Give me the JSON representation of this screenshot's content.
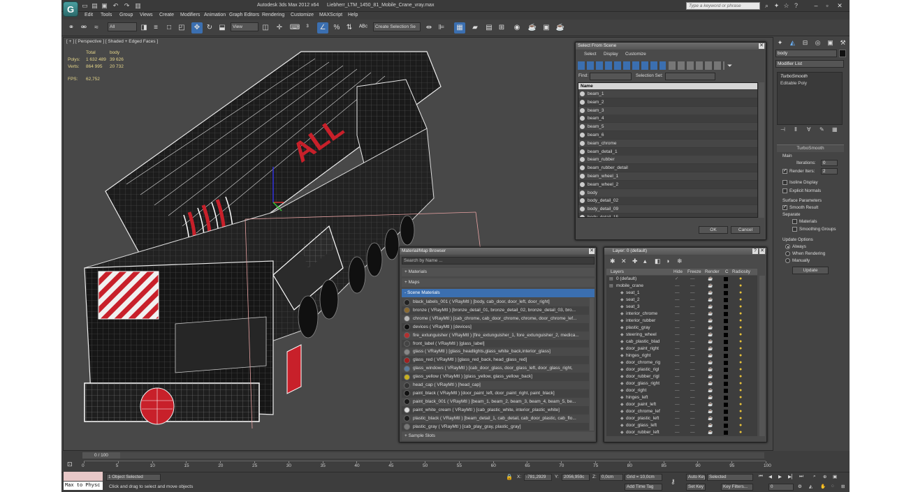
{
  "title": {
    "app": "Autodesk 3ds Max  2012 x64",
    "file": "Liebherr_LTM_1450_81_Mobile_Crane_vray.max",
    "logo_letter": "G",
    "search_placeholder": "Type a keyword or phrase"
  },
  "menu": [
    "Edit",
    "Tools",
    "Group",
    "Views",
    "Create",
    "Modifiers",
    "Animation",
    "Graph Editors",
    "Rendering",
    "Customize",
    "MAXScript",
    "Help"
  ],
  "toolbar": {
    "filter": "All",
    "ref_coord": "View",
    "selection_set": "Create Selection Se"
  },
  "viewport": {
    "label": "[ + ] [ Perspective ] [ Shaded + Edged Faces ]",
    "stats": {
      "col_total": "Total",
      "col_body": "body",
      "polys_label": "Polys:",
      "polys_total": "1 632 489",
      "polys_body": "39 626",
      "verts_label": "Verts:",
      "verts_total": "864 995",
      "verts_body": "20 732",
      "fps_label": "FPS:",
      "fps_value": "62,752"
    },
    "crane_text": "ALL"
  },
  "right_panel": {
    "object_name": "body",
    "modifier_list": "Modifier List",
    "stack": [
      "TurboSmooth",
      "Editable Poly"
    ],
    "turbosmooth": {
      "header": "TurboSmooth",
      "main": "Main",
      "iterations_label": "Iterations:",
      "iterations_value": "0",
      "render_iters_label": "Render Iters:",
      "render_iters_value": "2",
      "isoline": "Isoline Display",
      "explicit_normals": "Explicit Normals",
      "surface_params": "Surface Parameters",
      "smooth_result": "Smooth Result",
      "separate": "Separate",
      "materials": "Materials",
      "smoothing_groups": "Smoothing Groups",
      "update_options": "Update Options",
      "always": "Always",
      "when_rendering": "When Rendering",
      "manually": "Manually",
      "update_btn": "Update"
    }
  },
  "select_from_scene": {
    "title": "Select From Scene",
    "menu": [
      "Select",
      "Display",
      "Customize"
    ],
    "find_label": "Find:",
    "selection_set_label": "Selection Set:",
    "col_name": "Name",
    "items": [
      "beam_1",
      "beam_2",
      "beam_3",
      "beam_4",
      "beam_5",
      "beam_6",
      "beam_chrome",
      "beam_detail_1",
      "beam_rubber",
      "beam_rubber_detail",
      "beam_wheel_1",
      "beam_wheel_2",
      "body",
      "body_detail_02",
      "body_detail_09",
      "body_detail_15"
    ],
    "ok": "OK",
    "cancel": "Cancel"
  },
  "material_browser": {
    "title": "Material/Map Browser",
    "search_placeholder": "Search by Name ...",
    "sections": [
      "+ Materials",
      "+ Maps",
      "- Scene Materials"
    ],
    "materials": [
      "black_labels_001  ( VRayMtl ) [body, cab_door, door_left, door_right]",
      "bronze  ( VRayMtl ) [bronze_detail_01, bronze_detail_02, bronze_detail_03, bro...",
      "chrome  ( VRayMtl ) [cab_chrome, cab_door_chrome, chrome, door_chrome_lef...",
      "devices  ( VRayMtl ) [devices]",
      "fire_extunguisher  ( VRayMtl ) [fire_extunguisher_1, fore_extunguisher_2, medica...",
      "front_label  ( VRayMtl ) [glass_label]",
      "glass  ( VRayMtl ) [glass_headlights,glass_white_back,interior_glass]",
      "glass_red  ( VRayMtl ) [glass_red_back, head_glass_red]",
      "glass_windows  ( VRayMtl ) [cab_door_glass, door_glass_left, door_glass_right,",
      "glass_yellow  ( VRayMtl ) [glass_yellow, glass_yellow_back]",
      "head_cap  ( VRayMtl ) [head_cap]",
      "paint_black  ( VRayMtl ) [door_paint_left, door_paint_right, paint_black]",
      "paint_black_001  ( VRayMtl ) [beam_1, beam_2, beam_3, beam_4, beam_5, be...",
      "paint_white_cream  ( VRayMtl ) [cab_plastic_white, interior_plastic_white]",
      "plastic_black  ( VRayMtl ) [beam_detail_1, cab_detail, cab_door_plastic, cab_flo...",
      "plastic_gray  ( VRayMtl ) [cab_play_gray, plastic_gray]"
    ],
    "sample_slots": "+ Sample Slots"
  },
  "layer_manager": {
    "title": "Layer: 0 (default)",
    "columns": [
      "Layers",
      "Hide",
      "Freeze",
      "Render",
      "C",
      "Radiosity"
    ],
    "layers": [
      "0 (default)",
      "mobile_crane"
    ],
    "objects": [
      "seat_1",
      "seat_2",
      "seat_3",
      "interior_chrome",
      "interior_rubber",
      "plastic_gray",
      "steering_wheel",
      "cab_plastic_blad",
      "door_paint_right",
      "hinges_right",
      "door_chrome_rig",
      "door_plastic_rigl",
      "door_rubber_rigl",
      "door_glass_right",
      "door_right",
      "hinges_left",
      "door_paint_left",
      "door_chrome_lef",
      "door_plastic_left",
      "door_glass_left",
      "door_rubber_left"
    ]
  },
  "timeline": {
    "frame": "0 / 100",
    "ticks": [
      "0",
      "5",
      "10",
      "15",
      "20",
      "25",
      "30",
      "35",
      "40",
      "45",
      "50",
      "55",
      "60",
      "65",
      "70",
      "75",
      "80",
      "85",
      "90",
      "95",
      "100"
    ]
  },
  "status": {
    "maxscript": "Max to Physc",
    "selected": "1 Object Selected",
    "prompt": "Click and drag to select and move objects",
    "x_label": "X:",
    "x_value": "-781,2929",
    "y_label": "Y:",
    "y_value": "2056,959c",
    "z_label": "Z:",
    "z_value": "0,0cm",
    "grid": "Grid = 10,0cm",
    "add_time_tag": "Add Time Tag",
    "auto_key": "Auto Key",
    "auto_key_value": "Selected",
    "set_key": "Set Key",
    "key_filters": "Key Filters...",
    "frame_field": "0"
  },
  "colors": {
    "ui_bg": "#444444",
    "viewport_bg": "#484848",
    "highlight": "#3b6fb0",
    "wire": "#ffffff",
    "stats": "#e6d68a",
    "crane_red": "#c8202a"
  }
}
